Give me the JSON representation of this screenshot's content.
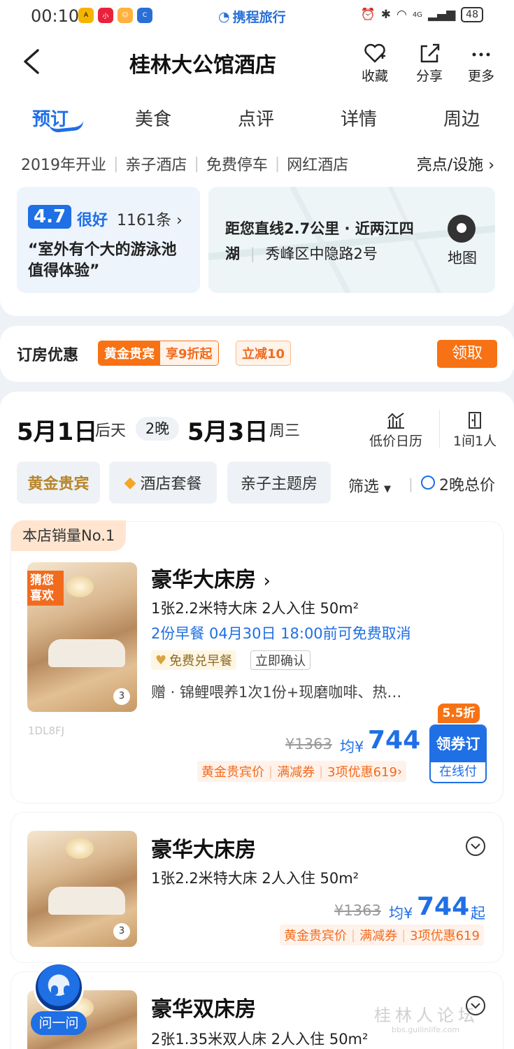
{
  "status_bar": {
    "time": "00:10",
    "brand": "携程旅行",
    "battery": "48",
    "network": "4G"
  },
  "header": {
    "title": "桂林大公馆酒店",
    "actions": [
      {
        "label": "收藏",
        "icon": "heart-plus-icon"
      },
      {
        "label": "分享",
        "icon": "share-icon"
      },
      {
        "label": "更多",
        "icon": "more-icon"
      }
    ]
  },
  "tabs": [
    "预订",
    "美食",
    "点评",
    "详情",
    "周边"
  ],
  "summary": {
    "features": [
      "2019年开业",
      "亲子酒店",
      "免费停车",
      "网红酒店"
    ],
    "amenities_link": "亮点/设施",
    "rating": {
      "score": "4.7",
      "label": "很好",
      "count": "1161条",
      "quote_line1": "“室外有个大的游泳池",
      "quote_line2": "值得体验”"
    },
    "location": {
      "line1": "距您直线2.7公里 · 近两江四",
      "line2_a": "湖",
      "line2_b": "秀峰区中隐路2号",
      "map_label": "地图"
    }
  },
  "promo": {
    "title": "订房优惠",
    "vip_label": "黄金贵宾",
    "vip_offer": "享9折起",
    "coupon": "立减10",
    "claim_label": "领取"
  },
  "booking": {
    "checkin_date": "5月1日",
    "checkin_day": "后天",
    "nights": "2晚",
    "checkout_date": "5月3日",
    "checkout_day": "周三",
    "calendar_label": "低价日历",
    "guests_label": "1间1人",
    "filters": [
      "黄金贵宾",
      "酒店套餐",
      "亲子主题房"
    ],
    "filter_label": "筛选",
    "total_price_label": "2晚总价"
  },
  "rooms": [
    {
      "badge": "本店销量No.1",
      "guess_badge": "猜您喜欢",
      "name": "豪华大床房",
      "spec": "1张2.2米特大床  2人入住  50m²",
      "policy": "2份早餐   04月30日 18:00前可免费取消",
      "perk_tag": "免费兑早餐",
      "confirm_tag": "立即确认",
      "gift": "赠 · 锦鲤喂养1次1份+现磨咖啡、热…",
      "image_count": "3",
      "image_code": "1DL8FJ",
      "price_old": "¥1363",
      "price_prefix": "均¥",
      "price": "744",
      "discount": "5.5折",
      "discounts": [
        "黄金贵宾价",
        "满减券",
        "3项优惠619"
      ],
      "book_label": "领券订",
      "pay_label": "在线付"
    },
    {
      "name": "豪华大床房",
      "spec": "1张2.2米特大床  2人入住  50m²",
      "image_count": "3",
      "price_old": "¥1363",
      "price_prefix": "均¥",
      "price": "744",
      "price_suffix": "起",
      "discounts": [
        "黄金贵宾价",
        "满减券",
        "3项优惠619"
      ]
    },
    {
      "name": "豪华双床房",
      "spec": "2张1.35米双人床  2人入住  50m²"
    }
  ],
  "assistant": {
    "label": "问一问"
  },
  "watermark": {
    "main": "桂林人论坛",
    "sub": "bbs.guilinlife.com"
  },
  "colors": {
    "accent": "#1f6fe5",
    "orange": "#f77214",
    "gold": "#b8862b"
  }
}
